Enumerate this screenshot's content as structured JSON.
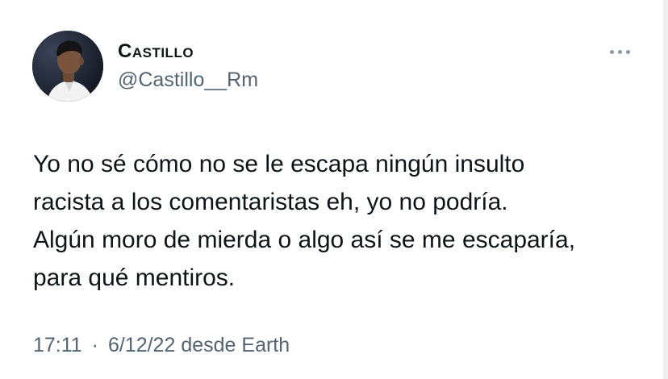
{
  "tweet": {
    "display_name": "Castillo",
    "handle": "@Castillo__Rm",
    "more_icon": "more-horizontal-icon",
    "text": "Yo no sé cómo no se le escapa ningún insulto\nracista a los comentaristas eh, yo no podría.\nAlgún moro de mierda o algo así se me escaparía,\npara qué mentiros.",
    "time": "17:11",
    "separator": "·",
    "date": "6/12/22",
    "source": "desde Earth"
  },
  "colors": {
    "text_primary": "#0f1419",
    "text_secondary": "#536471",
    "background": "#ffffff"
  }
}
